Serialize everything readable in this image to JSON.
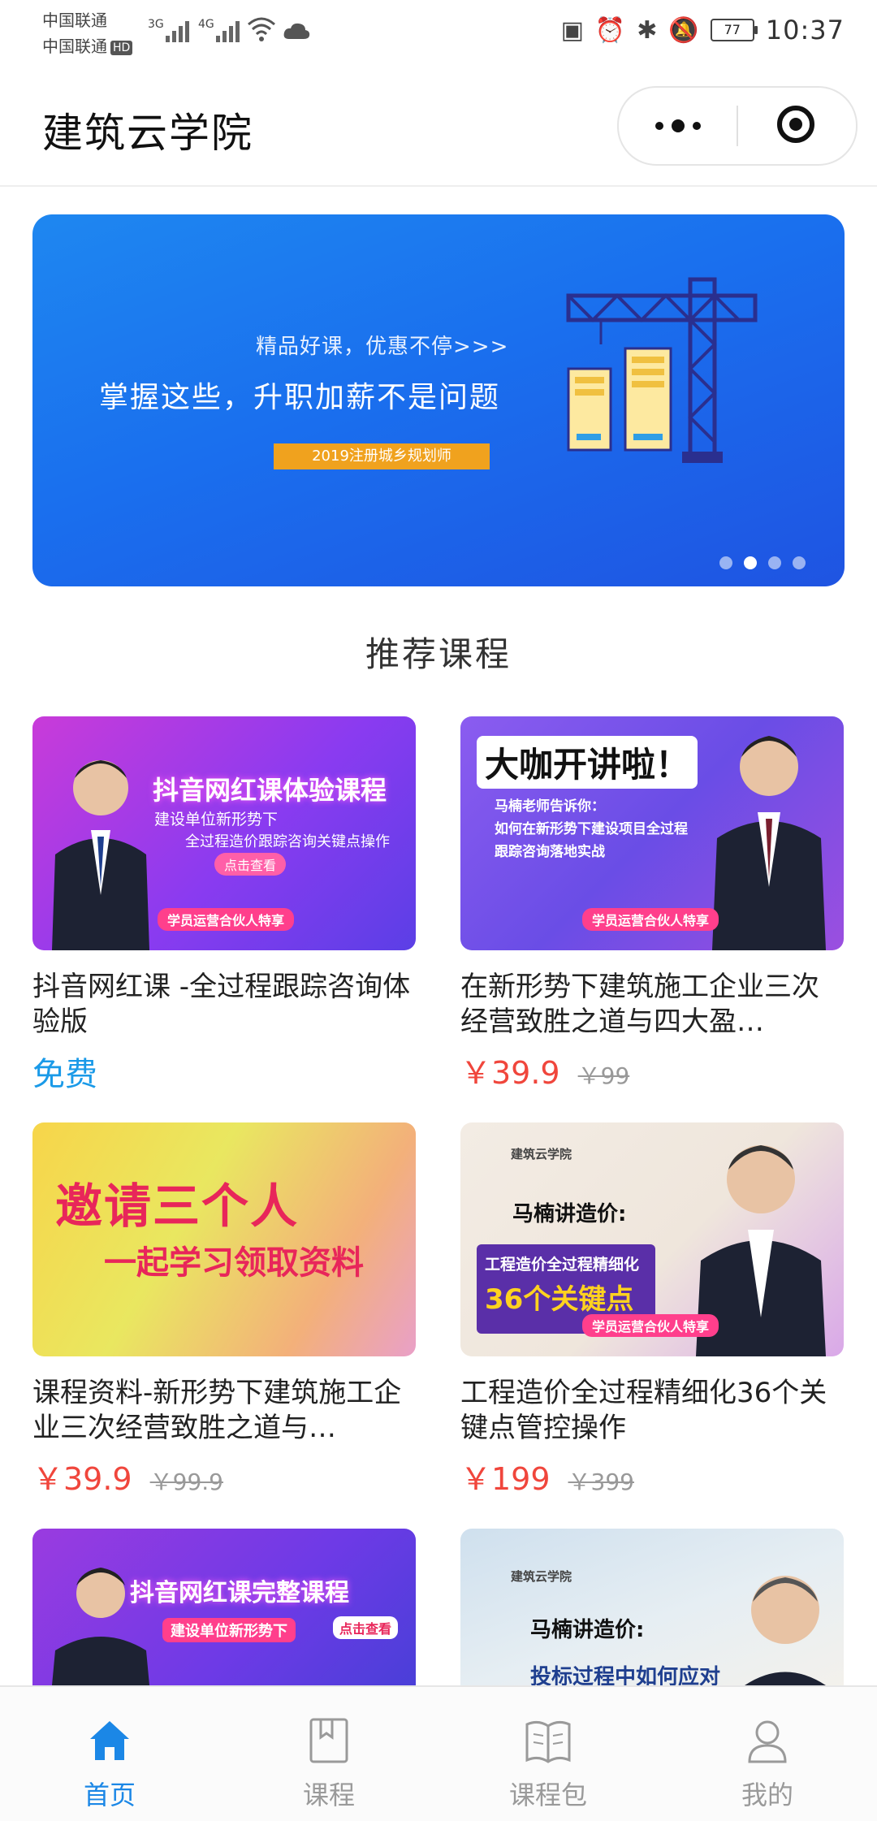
{
  "status_bar": {
    "carrier1": "中国联通",
    "carrier2": "中国联通",
    "hd": "HD",
    "net1": "3G",
    "net2": "4G",
    "battery": "77",
    "time": "10:37"
  },
  "title_bar": {
    "title": "建筑云学院"
  },
  "banner": {
    "tag": "精品好课，优惠不停>>>",
    "headline": "掌握这些，升职加薪不是问题",
    "label": "2019注册城乡规划师",
    "slides": 4,
    "active_slide": 2
  },
  "section": {
    "title": "推荐课程"
  },
  "courses": [
    {
      "thumb_line1": "抖音网红课体验课程",
      "thumb_line2": "建设单位新形势下",
      "thumb_line3": "全过程造价跟踪咨询关键点操作",
      "thumb_button": "点击查看",
      "thumb_badge": "学员运营合伙人特享",
      "title": "抖音网红课 -全过程跟踪咨询体验版",
      "price": "免费",
      "original_price": ""
    },
    {
      "thumb_line1": "大咖开讲啦！",
      "thumb_line2": "马楠老师告诉你：",
      "thumb_line3": "如何在新形势下建设项目全过程",
      "thumb_line4": "跟踪咨询落地实战",
      "thumb_badge": "学员运营合伙人特享",
      "title": "在新形势下建筑施工企业三次经营致胜之道与四大盈…",
      "price": "￥39.9",
      "original_price": "￥99"
    },
    {
      "thumb_line1": "邀请三个人",
      "thumb_line2": "一起学习领取资料",
      "title": "课程资料-新形势下建筑施工企业三次经营致胜之道与…",
      "price": "￥39.9",
      "original_price": "￥99.9"
    },
    {
      "thumb_logo": "建筑云学院",
      "thumb_line1": "马楠讲造价:",
      "thumb_line2": "工程造价全过程精细化",
      "thumb_line3": "36个关键点",
      "thumb_badge": "学员运营合伙人特享",
      "title": "工程造价全过程精细化36个关键点管控操作",
      "price": "￥199",
      "original_price": "￥399"
    },
    {
      "thumb_line1": "抖音网红课完整课程",
      "thumb_line2": "建设单位新形势下",
      "thumb_button": "点击查看"
    },
    {
      "thumb_logo": "建筑云学院",
      "thumb_line1": "马楠讲造价:",
      "thumb_line2": "投标过程中如何应对"
    }
  ],
  "tabbar": {
    "tabs": [
      {
        "label": "首页",
        "icon": "home-icon",
        "active": true
      },
      {
        "label": "课程",
        "icon": "book-icon",
        "active": false
      },
      {
        "label": "课程包",
        "icon": "open-book-icon",
        "active": false
      },
      {
        "label": "我的",
        "icon": "user-icon",
        "active": false
      }
    ],
    "active_color": "#1b87e6",
    "inactive_color": "#9a9a9a"
  }
}
